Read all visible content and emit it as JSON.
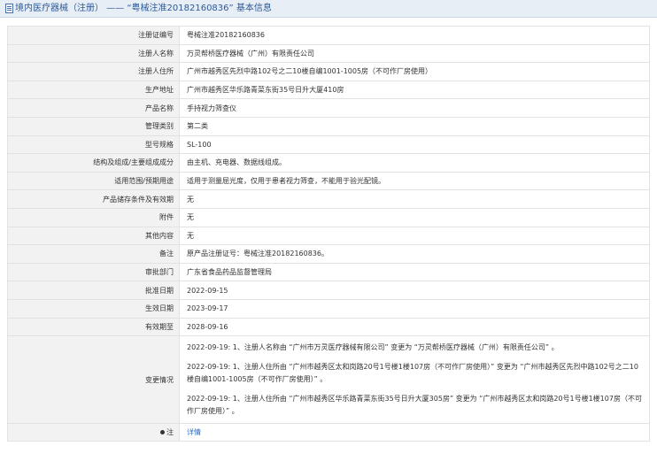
{
  "header": {
    "title": "境内医疗器械（注册） —— “粤械注准20182160836” 基本信息"
  },
  "rows": [
    {
      "label": "注册证编号",
      "value": "粤械注准20182160836"
    },
    {
      "label": "注册人名称",
      "value": "万灵帮桥医疗器械（广州）有限责任公司"
    },
    {
      "label": "注册人住所",
      "value": "广州市越秀区先烈中路102号之二10楼自编1001-1005房（不可作厂房使用）"
    },
    {
      "label": "生产地址",
      "value": "广州市越秀区华乐路青菜东街35号日升大厦410房"
    },
    {
      "label": "产品名称",
      "value": "手持视力筛查仪"
    },
    {
      "label": "管理类别",
      "value": "第二类"
    },
    {
      "label": "型号规格",
      "value": "SL-100"
    },
    {
      "label": "结构及组成/主要组成成分",
      "value": "由主机、充电器、数据线组成。"
    },
    {
      "label": "适用范围/预期用途",
      "value": "适用于测量屈光度，仅用于患者视力筛查，不能用于验光配镜。"
    },
    {
      "label": "产品储存条件及有效期",
      "value": "无"
    },
    {
      "label": "附件",
      "value": "无"
    },
    {
      "label": "其他内容",
      "value": "无"
    },
    {
      "label": "备注",
      "value": "原产品注册证号：粤械注准20182160836。"
    },
    {
      "label": "审批部门",
      "value": "广东省食品药品监督管理局"
    },
    {
      "label": "批准日期",
      "value": "2022-09-15"
    },
    {
      "label": "生效日期",
      "value": "2023-09-17"
    },
    {
      "label": "有效期至",
      "value": "2028-09-16"
    }
  ],
  "changes": {
    "label": "变更情况",
    "entries": [
      "2022-09-19: 1、注册人名称由 “广州市万灵医疗器械有限公司” 变更为 “万灵帮桥医疗器械（广州）有限责任公司” 。",
      "2022-09-19: 1、注册人住所由 “广州市越秀区太和岗路20号1号楼1楼107房（不可作厂房使用）” 变更为 “广州市越秀区先烈中路102号之二10楼自编1001-1005房（不可作厂房使用）” 。",
      "2022-09-19: 1、注册人住所由 “广州市越秀区华乐路青菜东街35号日升大厦305房” 变更为 “广州市越秀区太和岗路20号1号楼1楼107房（不可作厂房使用）” 。"
    ]
  },
  "note": {
    "label": "注",
    "link_text": "详情"
  }
}
